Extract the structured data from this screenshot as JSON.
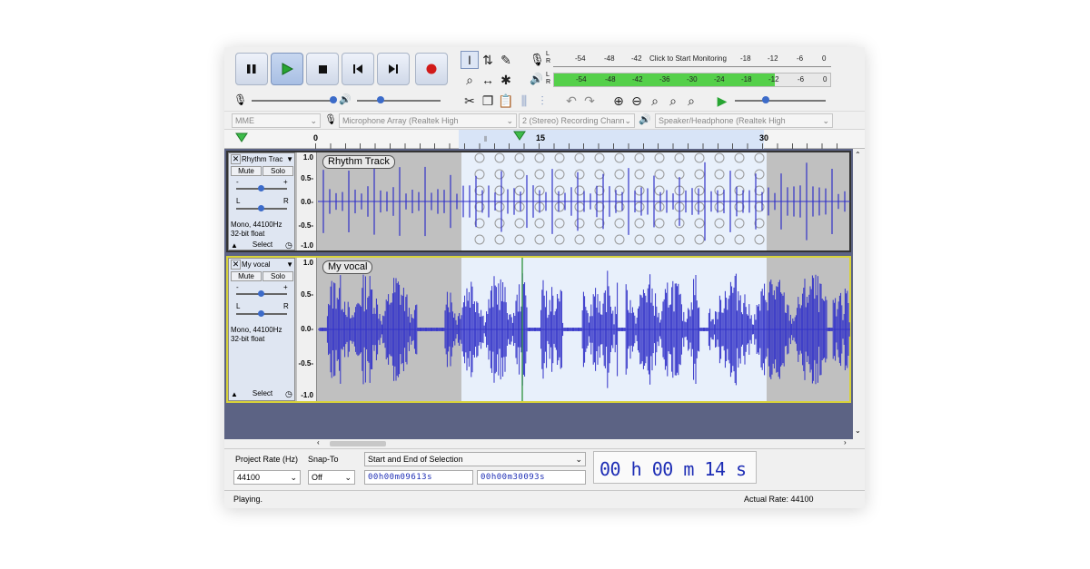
{
  "transport": {
    "pause_icon": "pause-icon",
    "play_icon": "play-icon",
    "stop_icon": "stop-icon",
    "skip_start_icon": "skip-to-start-icon",
    "skip_end_icon": "skip-to-end-icon",
    "record_icon": "record-icon"
  },
  "meters": {
    "record_scale": [
      "-54",
      "-48",
      "-42",
      "-18",
      "-12",
      "-6",
      "0"
    ],
    "record_prompt": "Click to Start Monitoring",
    "play_scale": [
      "-54",
      "-48",
      "-42",
      "-36",
      "-30",
      "-24",
      "-18",
      "-12",
      "-6",
      "0"
    ],
    "play_level_percent": 80,
    "lr": [
      "L",
      "R"
    ]
  },
  "devices": {
    "host": "MME",
    "mic": "Microphone Array (Realtek High",
    "channels": "2 (Stereo) Recording Chann",
    "speaker": "Speaker/Headphone (Realtek High"
  },
  "timeline": {
    "ticks": [
      "0",
      "15",
      "30"
    ]
  },
  "tracks": [
    {
      "name": "Rhythm Trac",
      "title": "Rhythm Track",
      "mute": "Mute",
      "solo": "Solo",
      "gain_minus": "-",
      "gain_plus": "+",
      "pan_l": "L",
      "pan_r": "R",
      "info1": "Mono, 44100Hz",
      "info2": "32-bit float",
      "select": "Select",
      "scale": [
        "1.0",
        "0.5-",
        "0.0-",
        "-0.5-",
        "-1.0"
      ]
    },
    {
      "name": "My vocal",
      "title": "My vocal",
      "mute": "Mute",
      "solo": "Solo",
      "gain_minus": "-",
      "gain_plus": "+",
      "pan_l": "L",
      "pan_r": "R",
      "info1": "Mono, 44100Hz",
      "info2": "32-bit float",
      "select": "Select",
      "scale": [
        "1.0",
        "0.5-",
        "0.0-",
        "-0.5-",
        "-1.0"
      ]
    }
  ],
  "bottom": {
    "rate_label": "Project Rate (Hz)",
    "rate_value": "44100",
    "snap_label": "Snap-To",
    "snap_value": "Off",
    "selection_label": "Start and End of Selection",
    "start": "00h00m09613s",
    "end": "00h00m30093s",
    "big_time": "00 h 00 m 14 s"
  },
  "status": {
    "left": "Playing.",
    "right": "Actual Rate: 44100"
  },
  "colors": {
    "waveform": "#3232c8",
    "selection": "#e8f0fb",
    "unselected": "#c0c0c0",
    "meter_green": "#55d04a",
    "track_area_bg": "#5c6384",
    "time_digits": "#1d2db5"
  }
}
